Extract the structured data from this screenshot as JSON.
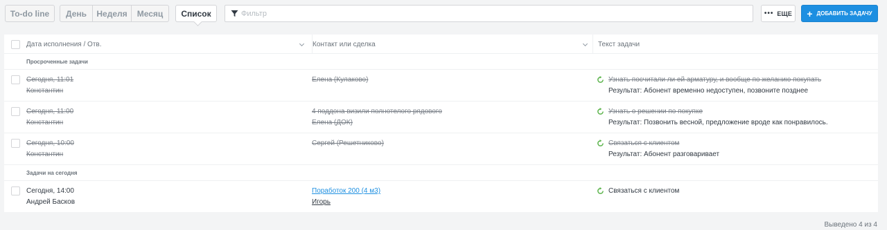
{
  "toolbar": {
    "todo_label": "To-do line",
    "day_label": "День",
    "week_label": "Неделя",
    "month_label": "Месяц",
    "list_label": "Список",
    "filter_placeholder": "Фильтр",
    "more_label": "ЕЩЕ",
    "add_label": "ДОБАВИТЬ ЗАДАЧУ",
    "accent_color": "#1d8fe1"
  },
  "table": {
    "columns": [
      "Дата исполнения / Отв.",
      "Контакт или сделка",
      "Текст задачи"
    ],
    "groups": [
      {
        "title": "Просроченные задачи",
        "rows": [
          {
            "date": "Сегодня, 11:01",
            "owner": "Константин",
            "contact": "Елена (Кулаково)",
            "contact2": "",
            "task": "Узнать посчитали ли ей арматуру, и вообще по желанию покупать",
            "result": "Результат: Абонент временно недоступен, позвоните позднее"
          },
          {
            "date": "Сегодня, 11:00",
            "owner": "Константин",
            "contact": "4 поддона визили полнотелого рядового",
            "contact2": "Елена (ДОК)",
            "task": "Узнать о решении по покупке",
            "result": "Результат: Позвонить весной, предложение вроде как понравилось."
          },
          {
            "date": "Сегодня, 10:00",
            "owner": "Константин",
            "contact": "Сергей (Решетниково)",
            "contact2": "",
            "task": "Связаться с клиентом",
            "result": "Результат: Абонент разговаривает"
          }
        ]
      },
      {
        "title": "Задачи на сегодня",
        "rows": [
          {
            "date": "Сегодня, 14:00",
            "owner": "Андрей Басков",
            "contact": "Поработок 200 (4 м3)",
            "contact2": "Игорь",
            "task": "Связаться с клиентом",
            "result": ""
          }
        ]
      }
    ]
  },
  "footer": {
    "count_text": "Выведено 4 из 4"
  }
}
